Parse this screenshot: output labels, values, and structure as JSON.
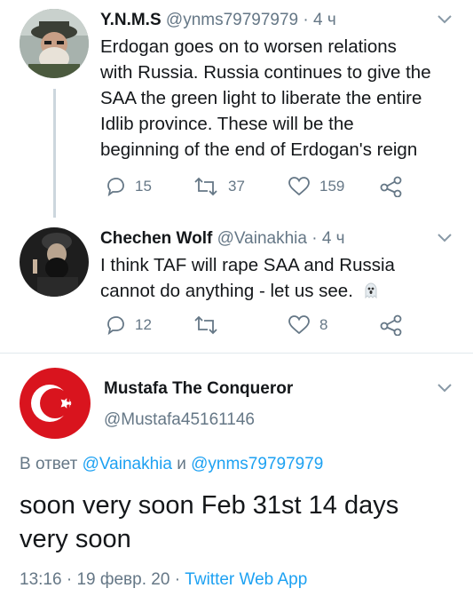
{
  "tweets": [
    {
      "name": "Y.N.M.S",
      "handle": "@ynms79797979",
      "sep": "·",
      "time": "4 ч",
      "lines": [
        "Erdogan goes on to worsen relations",
        "with Russia. Russia continues to give the",
        "SAA the green light to liberate the entire",
        "Idlib province. These will be the",
        "beginning of the end of Erdogan's reign"
      ],
      "replies": "15",
      "retweets": "37",
      "likes": "159"
    },
    {
      "name": "Chechen Wolf",
      "handle": "@Vainakhia",
      "sep": "·",
      "time": "4 ч",
      "lines": [
        "I think TAF will rape SAA and Russia",
        "cannot do anything - let us see."
      ],
      "emoji": "ghost-emoji",
      "replies": "12",
      "retweets": "",
      "likes": "8"
    }
  ],
  "main_tweet": {
    "name": "Mustafa The Conqueror",
    "handle": "@Mustafa45161146",
    "reply_prefix": "В ответ",
    "reply_user1": "@Vainakhia",
    "reply_and": "и",
    "reply_user2": "@ynms79797979",
    "text_line1": "soon very soon Feb 31st 14 days",
    "text_line2": "very soon",
    "time": "13:16",
    "sep": "·",
    "date": "19 февр. 20",
    "sep2": "·",
    "source": "Twitter Web App"
  },
  "colors": {
    "text": "#14171a",
    "muted": "#657786",
    "link": "#1da1f2",
    "avatar_red": "#d9141e"
  },
  "icons": [
    "reply-icon",
    "retweet-icon",
    "like-icon",
    "share-icon",
    "chevron-down-icon",
    "crescent-star-icon"
  ]
}
